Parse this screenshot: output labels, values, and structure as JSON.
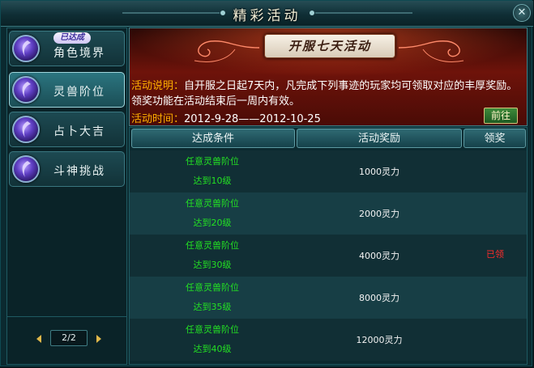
{
  "window": {
    "title": "精彩活动",
    "close_symbol": "✕"
  },
  "sidebar": {
    "items": [
      {
        "label": "角色境界",
        "badge": "已达成",
        "active": false
      },
      {
        "label": "灵兽阶位",
        "badge": "",
        "active": true
      },
      {
        "label": "占卜大吉",
        "badge": "",
        "active": false
      },
      {
        "label": "斗神挑战",
        "badge": "",
        "active": false
      }
    ],
    "pager": {
      "text": "2/2"
    }
  },
  "banner": {
    "title": "开服七天活动",
    "desc_label": "活动说明：",
    "desc_text": "自开服之日起7天内，凡完成下列事迹的玩家均可领取对应的丰厚奖励。领奖功能在活动结束后一周内有效。",
    "time_label": "活动时间：",
    "time_text": "2012-9-28——2012-10-25",
    "goto_label": "前往"
  },
  "table": {
    "headers": [
      "达成条件",
      "活动奖励",
      "领奖"
    ],
    "rows": [
      {
        "cond1": "任意灵兽阶位",
        "cond2": "达到10级",
        "reward": "1000灵力",
        "status": ""
      },
      {
        "cond1": "任意灵兽阶位",
        "cond2": "达到20级",
        "reward": "2000灵力",
        "status": ""
      },
      {
        "cond1": "任意灵兽阶位",
        "cond2": "达到30级",
        "reward": "4000灵力",
        "status": "已领"
      },
      {
        "cond1": "任意灵兽阶位",
        "cond2": "达到35级",
        "reward": "8000灵力",
        "status": ""
      },
      {
        "cond1": "任意灵兽阶位",
        "cond2": "达到40级",
        "reward": "12000灵力",
        "status": ""
      }
    ]
  },
  "colors": {
    "condition_text": "#23e023",
    "status_claimed": "#ff2b2b",
    "highlight_label": "#ffb000"
  }
}
